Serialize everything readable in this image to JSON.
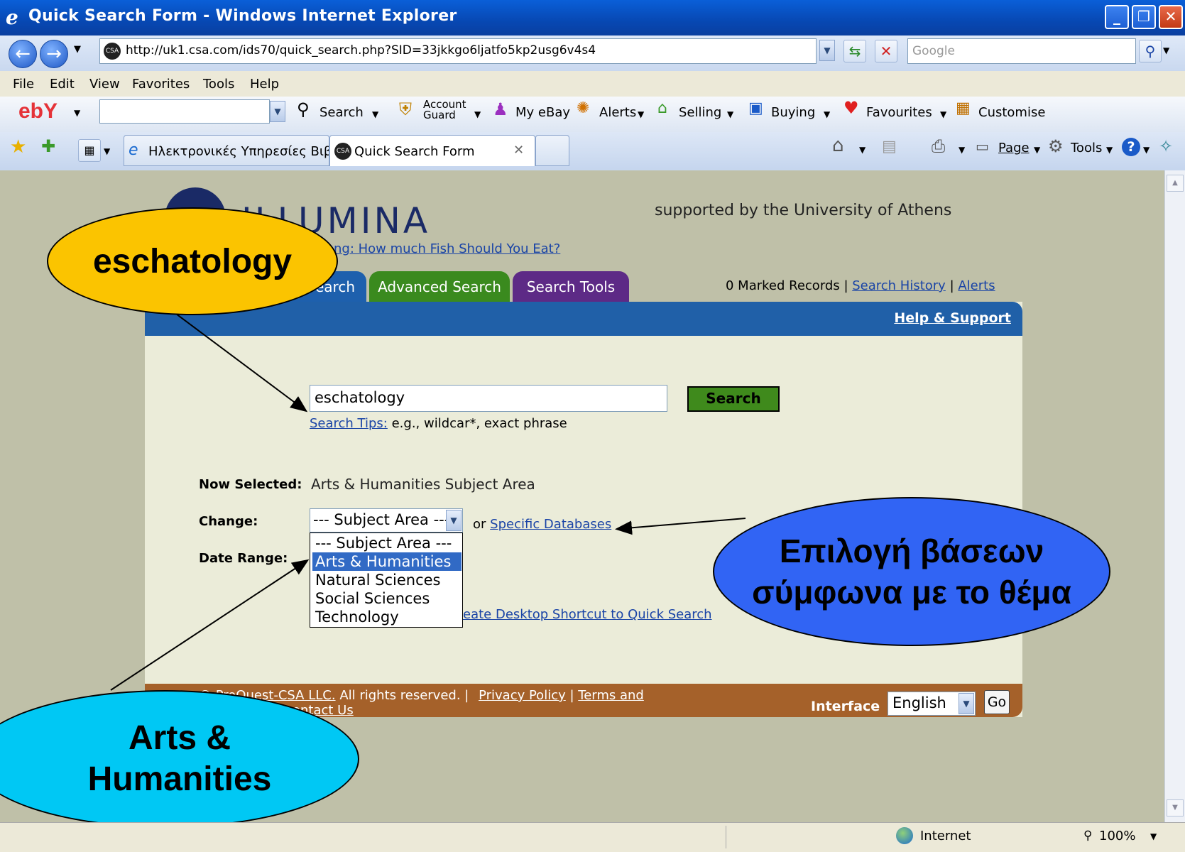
{
  "window": {
    "title": "Quick Search Form - Windows Internet Explorer"
  },
  "address": {
    "url": "http://uk1.csa.com/ids70/quick_search.php?SID=33jkkgo6ljatfo5kp2usg6v4s4",
    "search_placeholder": "Google",
    "site_icon": "CSA"
  },
  "menu": [
    "File",
    "Edit",
    "View",
    "Favorites",
    "Tools",
    "Help"
  ],
  "ebay_toolbar": {
    "logo": "ebY",
    "search": "Search",
    "account_guard_1": "Account",
    "account_guard_2": "Guard",
    "my_ebay": "My eBay",
    "alerts": "Alerts",
    "selling": "Selling",
    "buying": "Buying",
    "favourites": "Favourites",
    "customise": "Customise"
  },
  "tabs": [
    {
      "label": "Ηλεκτρονικές Υπηρεσίες Βιβλι..."
    },
    {
      "label": "Quick Search Form"
    }
  ],
  "command_bar": {
    "page": "Page",
    "tools": "Tools"
  },
  "page": {
    "logo_text": "ILLUMINA",
    "supported_by": "supported by the University of Athens",
    "news_link": "ng: How much Fish Should You Eat?",
    "tab_quick": "earch",
    "tab_advanced": "Advanced Search",
    "tab_tools": "Search Tools",
    "marked_records": "0 Marked Records",
    "search_history": "Search History",
    "alerts": "Alerts",
    "help_support": "Help & Support",
    "search_value": "eschatology",
    "search_button": "Search",
    "search_tips_link": "Search Tips:",
    "search_tips_text": "e.g., wildcar*, exact phrase",
    "now_selected_label": "Now Selected:",
    "now_selected_value": "Arts & Humanities Subject Area",
    "change_label": "Change:",
    "select_value": "--- Subject Area ---",
    "or_text": "or",
    "specific_databases": "Specific Databases",
    "date_range_label": "Date Range:",
    "dropdown_options": [
      "--- Subject Area ---",
      "Arts & Humanities",
      "Natural Sciences",
      "Social Sciences",
      "Technology"
    ],
    "desktop_shortcut": "eate Desktop Shortcut to Quick Search",
    "footer_copyright": "© ProQuest-CSA LLC.",
    "footer_rights": "All rights reserved. |",
    "privacy_policy": "Privacy Policy",
    "terms": "Terms and",
    "contact_us": "ontact Us",
    "interface_label": "Interface",
    "interface_value": "English",
    "go_button": "Go"
  },
  "callouts": {
    "eschatology": "eschatology",
    "greek_line1": "Επιλογή βάσεων",
    "greek_line2": "σύμφωνα με το θέμα",
    "arts_line1": "Arts  &",
    "arts_line2": "Humanities"
  },
  "status": {
    "zone": "Internet",
    "zoom": "100%"
  }
}
